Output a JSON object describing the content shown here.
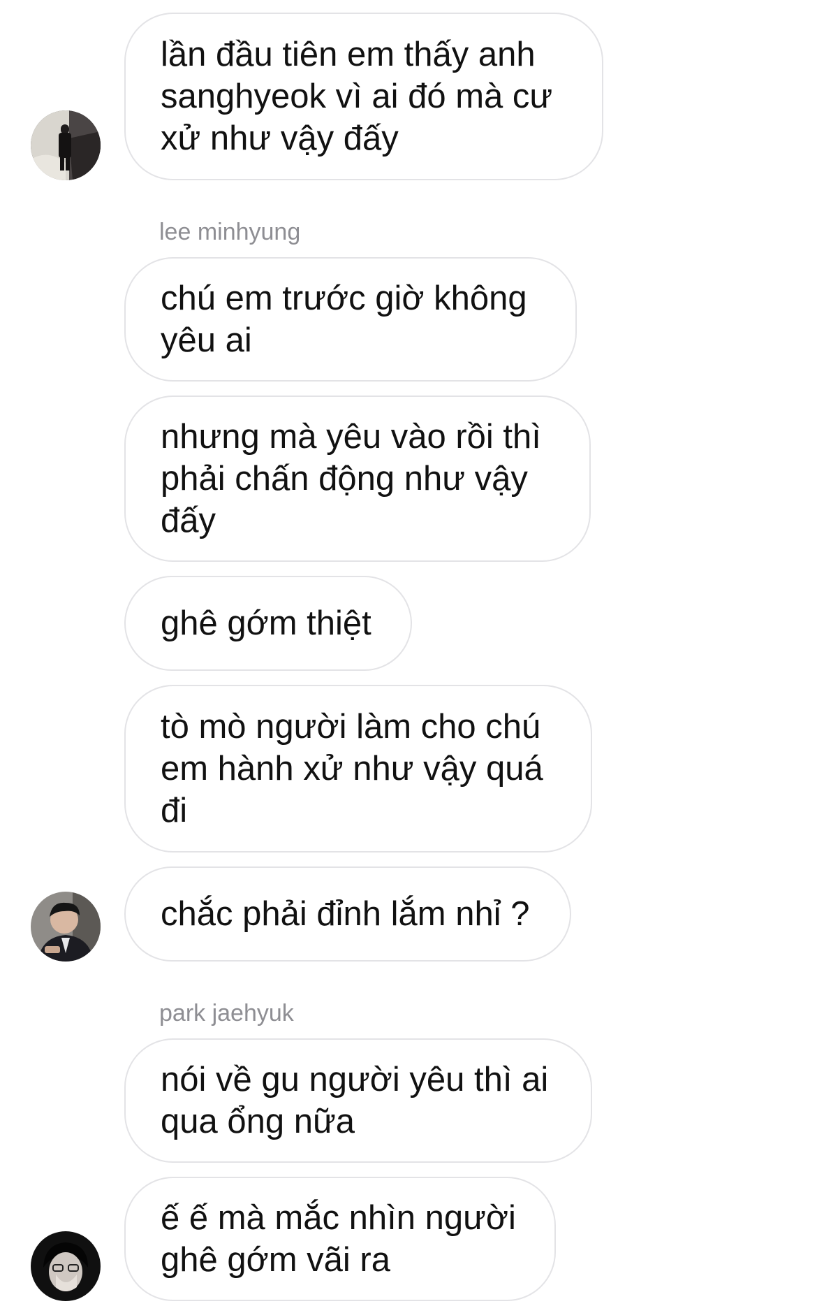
{
  "messages": [
    {
      "text": "lần đầu tiên em thấy anh sanghyeok vì ai đó mà cư xử như vậy đấy"
    },
    {
      "sender": "lee minhyung"
    },
    {
      "text": "chú em trước giờ không yêu ai"
    },
    {
      "text": "nhưng mà yêu vào rồi thì phải chấn động như vậy đấy"
    },
    {
      "text": "ghê gớm thiệt"
    },
    {
      "text": "tò mò người làm cho chú em hành xử như vậy quá đi"
    },
    {
      "text": "chắc phải đỉnh lắm nhỉ ?"
    },
    {
      "sender": "park jaehyuk"
    },
    {
      "text": "nói về gu người yêu thì ai qua ổng nữa"
    },
    {
      "text": "ế ế mà mắc nhìn người ghê gớm vãi ra"
    }
  ],
  "colors": {
    "bubble_border": "#e3e3e6",
    "sender_label": "#8e8e93",
    "text": "#111111"
  },
  "icons": [
    "avatar-photo-1",
    "avatar-photo-2",
    "avatar-photo-3"
  ]
}
